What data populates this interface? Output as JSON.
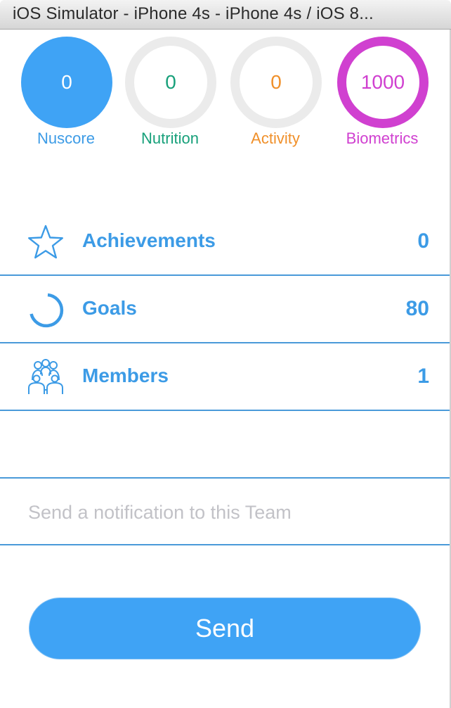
{
  "window": {
    "title": "iOS Simulator - iPhone 4s - iPhone 4s / iOS 8..."
  },
  "metrics": [
    {
      "name": "Nuscore",
      "value": "0",
      "color": "#3fa3f5",
      "style": "filled-circle"
    },
    {
      "name": "Nutrition",
      "value": "0",
      "color": "#17a07a",
      "style": "grey-ring"
    },
    {
      "name": "Activity",
      "value": "0",
      "color": "#f0902a",
      "style": "grey-ring"
    },
    {
      "name": "Biometrics",
      "value": "1000",
      "color": "#d040d0",
      "style": "colored-ring"
    }
  ],
  "rows": [
    {
      "label": "Achievements",
      "count": "0",
      "icon": "star-icon"
    },
    {
      "label": "Goals",
      "count": "80",
      "icon": "progress-arc-icon"
    },
    {
      "label": "Members",
      "count": "1",
      "icon": "team-members-icon"
    }
  ],
  "notification": {
    "placeholder": "Send a notification to this Team",
    "value": ""
  },
  "send_button": {
    "label": "Send"
  },
  "colors": {
    "accent": "#3c9be6",
    "button": "#3fa3f5",
    "ring_grey": "#ebebeb"
  }
}
